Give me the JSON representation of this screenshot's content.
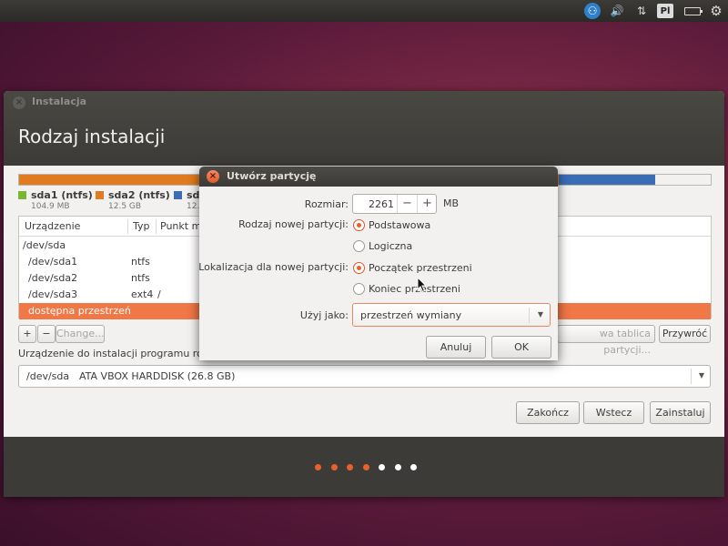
{
  "top_panel": {
    "keyboard_layout": "Pl",
    "icons": [
      "accessibility-icon",
      "volume-icon",
      "network-icon",
      "keyboard-layout-indicator",
      "battery-icon",
      "gear-icon"
    ]
  },
  "installer": {
    "window_title": "Instalacja",
    "heading": "Rodzaj instalacji",
    "partition_bar": {
      "segments": [
        {
          "name": "sda1",
          "color": "#e07b1f",
          "fraction": 0.78
        },
        {
          "name": "sda2",
          "color": "#3b6db5",
          "fraction": 0.14
        },
        {
          "name": "free",
          "color": "#f2f1f0",
          "fraction": 0.08
        }
      ]
    },
    "legend": [
      {
        "name": "sda1 (ntfs)",
        "size": "104.9 MB",
        "color": "#79b631"
      },
      {
        "name": "sda2 (ntfs)",
        "size": "12.5 GB",
        "color": "#e07b1f"
      },
      {
        "name": "sd",
        "size": "12.",
        "color": "#3b6db5"
      }
    ],
    "table": {
      "columns": [
        "Urządzenie",
        "Typ",
        "Punkt m"
      ],
      "rows": [
        {
          "device": "/dev/sda",
          "type": "",
          "mount": "",
          "selected": false
        },
        {
          "device": "/dev/sda1",
          "type": "ntfs",
          "mount": "",
          "selected": false
        },
        {
          "device": "/dev/sda2",
          "type": "ntfs",
          "mount": "",
          "selected": false
        },
        {
          "device": "/dev/sda3",
          "type": "ext4",
          "mount": "/",
          "selected": false
        },
        {
          "device": "dostępna przestrzeń",
          "type": "",
          "mount": "",
          "selected": true
        }
      ]
    },
    "buttons": {
      "add": "+",
      "remove": "−",
      "change": "Change...",
      "new_table": "wa tablica partycji...",
      "revert": "Przywróć",
      "quit": "Zakończ",
      "back": "Wstecz",
      "install": "Zainstaluj"
    },
    "boot_loader_label": "Urządzenie do instalacji programu roz",
    "boot_device": {
      "device": "/dev/sda",
      "description": "ATA VBOX HARDDISK (26.8 GB)"
    },
    "progress_dots": [
      {
        "state": "done",
        "color": "#e8612c"
      },
      {
        "state": "done",
        "color": "#e8612c"
      },
      {
        "state": "done",
        "color": "#e8612c"
      },
      {
        "state": "done",
        "color": "#e8612c"
      },
      {
        "state": "todo",
        "color": "#ffffff"
      },
      {
        "state": "todo",
        "color": "#ffffff"
      },
      {
        "state": "todo",
        "color": "#ffffff"
      }
    ]
  },
  "dialog": {
    "title": "Utwórz partycję",
    "size_label": "Rozmiar:",
    "size_value": "2261",
    "size_minus": "−",
    "size_plus": "+",
    "size_unit": "MB",
    "type_label": "Rodzaj nowej partycji:",
    "type_options": [
      {
        "label": "Podstawowa",
        "selected": true
      },
      {
        "label": "Logiczna",
        "selected": false
      }
    ],
    "location_label": "Lokalizacja dla nowej partycji:",
    "location_options": [
      {
        "label": "Początek przestrzeni",
        "selected": true
      },
      {
        "label": "Koniec przestrzeni",
        "selected": false
      }
    ],
    "use_as_label": "Użyj jako:",
    "use_as_value": "przestrzeń wymiany",
    "cancel": "Anuluj",
    "ok": "OK"
  }
}
